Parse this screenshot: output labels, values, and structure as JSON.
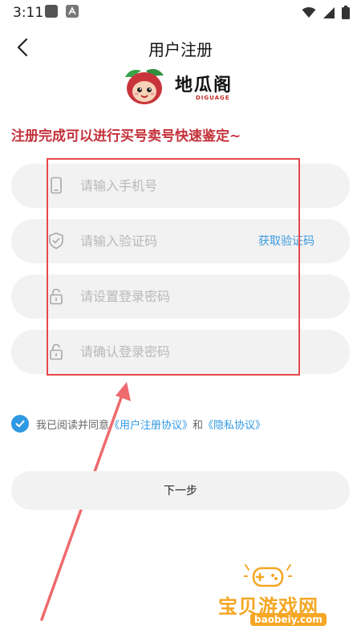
{
  "status_bar": {
    "time": "3:11",
    "icons": [
      "app-icon",
      "font-icon",
      "wifi-icon",
      "signal-icon",
      "battery-icon"
    ]
  },
  "header": {
    "title": "用户注册",
    "back_icon": "chevron-left-icon"
  },
  "logo": {
    "name": "地瓜阁",
    "subtitle": "DIGUAGE"
  },
  "headline": "注册完成可以进行买号卖号快速鉴定~",
  "form": {
    "phone": {
      "placeholder": "请输入手机号",
      "value": "",
      "icon": "phone-icon"
    },
    "code": {
      "placeholder": "请输入验证码",
      "value": "",
      "icon": "shield-icon",
      "action_label": "获取验证码"
    },
    "password": {
      "placeholder": "请设置登录密码",
      "value": "",
      "icon": "lock-icon"
    },
    "confirm_password": {
      "placeholder": "请确认登录密码",
      "value": "",
      "icon": "lock-icon"
    }
  },
  "agreement": {
    "checked": true,
    "prefix": "我已阅读并同意",
    "terms_link": "《用户注册协议》",
    "connector": "和",
    "privacy_link": "《隐私协议》"
  },
  "next_button_label": "下一步",
  "watermark": {
    "main": "宝贝游戏网",
    "url": "baobeiy.com"
  },
  "colors": {
    "accent": "#2f98e2",
    "headline_red": "#c4313a",
    "annotation_red": "#e8484c",
    "watermark_orange": "#f5a623",
    "field_bg": "#f2f2f2"
  }
}
